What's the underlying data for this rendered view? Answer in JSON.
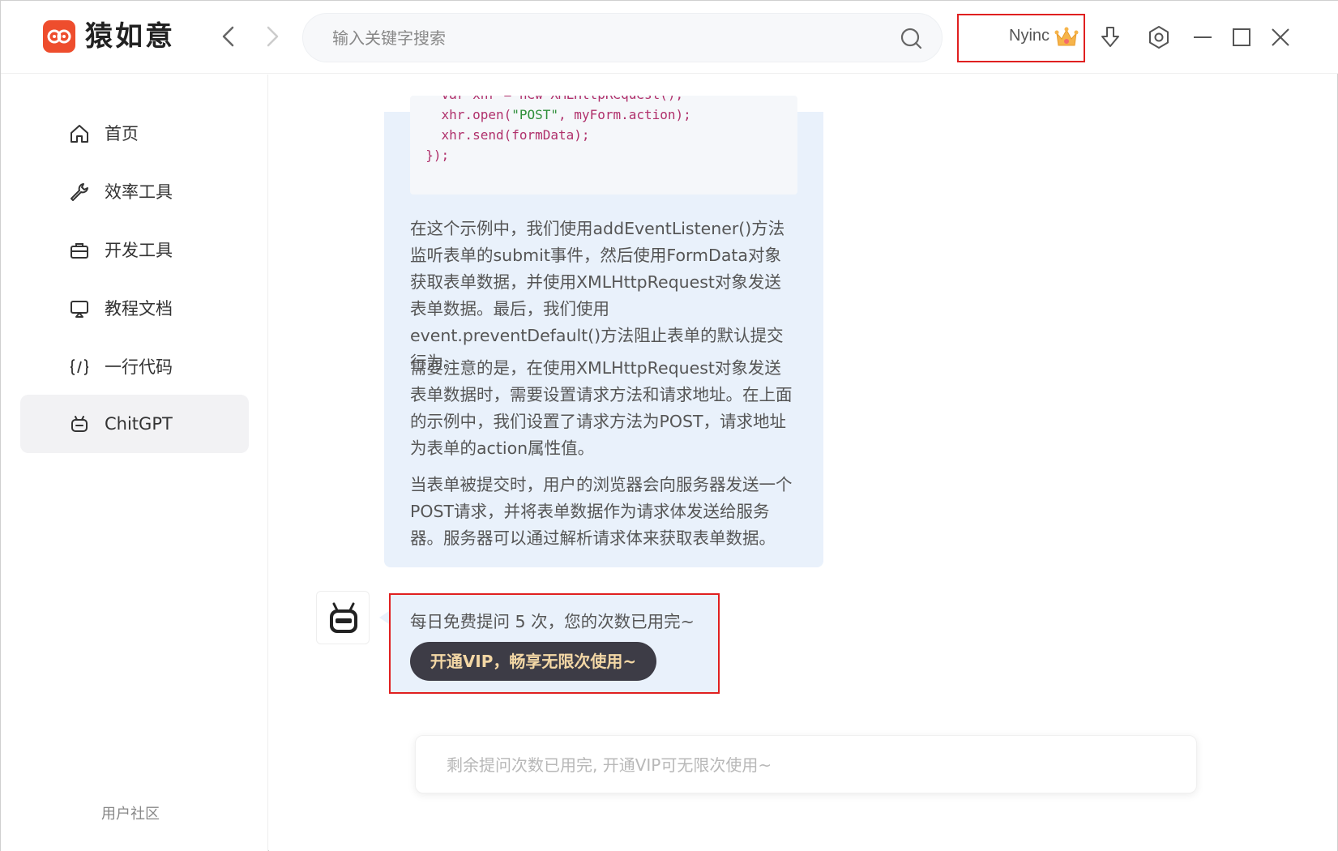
{
  "app": {
    "name": "猿如意",
    "brand_color": "#ee4d2d"
  },
  "header": {
    "search_placeholder": "输入关键字搜索",
    "user_name": "Nyinc",
    "icons": [
      "back-icon",
      "forward-icon",
      "search-icon",
      "crown-icon",
      "download-icon",
      "settings-icon",
      "minimize-icon",
      "maximize-icon",
      "close-icon"
    ]
  },
  "sidebar": {
    "items": [
      {
        "label": "首页",
        "icon": "home-icon"
      },
      {
        "label": "效率工具",
        "icon": "wrench-icon"
      },
      {
        "label": "开发工具",
        "icon": "toolbox-icon"
      },
      {
        "label": "教程文档",
        "icon": "screen-icon"
      },
      {
        "label": "一行代码",
        "icon": "code-icon"
      },
      {
        "label": "ChitGPT",
        "icon": "robot-icon",
        "active": true
      }
    ],
    "community": "用户社区"
  },
  "chat": {
    "code_lines": [
      "    var xhr = new XMLHttpRequest();",
      "    xhr.open(\"POST\", myForm.action);",
      "    xhr.send(formData);",
      "  });"
    ],
    "paragraphs": [
      "在这个示例中，我们使用addEventListener()方法监听表单的submit事件，然后使用FormData对象获取表单数据，并使用XMLHttpRequest对象发送表单数据。最后，我们使用event.preventDefault()方法阻止表单的默认提交行为。",
      "需要注意的是，在使用XMLHttpRequest对象发送表单数据时，需要设置请求方法和请求地址。在上面的示例中，我们设置了请求方法为POST，请求地址为表单的action属性值。",
      "当表单被提交时，用户的浏览器会向服务器发送一个POST请求，并将表单数据作为请求体发送给服务器。服务器可以通过解析请求体来获取表单数据。"
    ],
    "notice": "每日免费提问 5 次，您的次数已用完~",
    "vip_button": "开通VIP，畅享无限次使用~",
    "input_placeholder": "剩余提问次数已用完, 开通VIP可无限次使用~",
    "bubble_color": "#e9f1fb",
    "highlight_color": "#e02020"
  }
}
